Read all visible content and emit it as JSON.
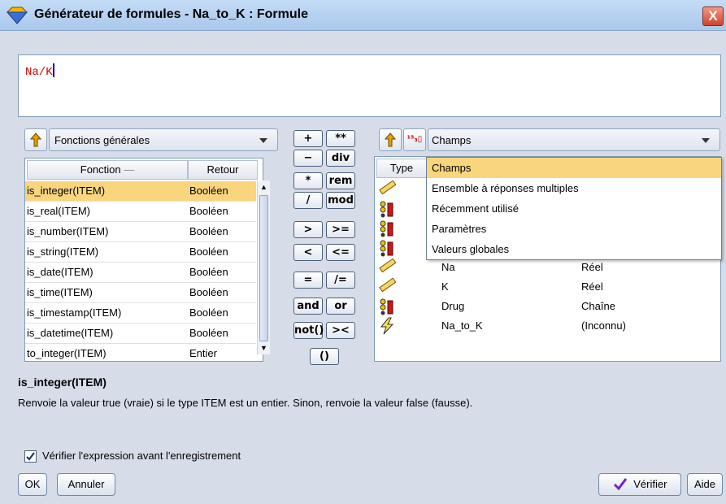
{
  "window": {
    "title": "Générateur de formules - Na_to_K : Formule",
    "close_label": "X"
  },
  "expression": {
    "text": "Na/K"
  },
  "functions": {
    "category": "Fonctions générales",
    "columns": [
      "Fonction",
      "Retour"
    ],
    "rows": [
      {
        "name": "is_integer(ITEM)",
        "ret": "Booléen"
      },
      {
        "name": "is_real(ITEM)",
        "ret": "Booléen"
      },
      {
        "name": "is_number(ITEM)",
        "ret": "Booléen"
      },
      {
        "name": "is_string(ITEM)",
        "ret": "Booléen"
      },
      {
        "name": "is_date(ITEM)",
        "ret": "Booléen"
      },
      {
        "name": "is_time(ITEM)",
        "ret": "Booléen"
      },
      {
        "name": "is_timestamp(ITEM)",
        "ret": "Booléen"
      },
      {
        "name": "is_datetime(ITEM)",
        "ret": "Booléen"
      },
      {
        "name": "to_integer(ITEM)",
        "ret": "Entier"
      }
    ],
    "selected_index": 0
  },
  "operators": [
    "+",
    "**",
    "−",
    "div",
    "*",
    "rem",
    "/",
    "mod",
    ">",
    ">=",
    "<",
    "<=",
    "=",
    "/=",
    "and",
    "or",
    "not()",
    "><",
    "()"
  ],
  "fields": {
    "source": "Champs",
    "type_header": "Type",
    "dropdown_options": [
      "Champs",
      "Ensemble à réponses multiples",
      "Récemment utilisé",
      "Paramètres",
      "Valeurs globales"
    ],
    "highlighted_option": "Champs",
    "rows": [
      {
        "type_icon": "continuous-ruler-icon",
        "name": "Na",
        "storage": "Réel"
      },
      {
        "type_icon": "continuous-ruler-icon",
        "name": "K",
        "storage": "Réel"
      },
      {
        "type_icon": "nominal-set-icon",
        "name": "Drug",
        "storage": "Chaîne"
      },
      {
        "type_icon": "derived-lightning-icon",
        "name": "Na_to_K",
        "storage": "(Inconnu)"
      }
    ]
  },
  "description": {
    "title": "is_integer(ITEM)",
    "text": "Renvoie la valeur true (vraie) si le type ITEM est un entier. Sinon, renvoie la valeur false (fausse)."
  },
  "check_before_save": {
    "label": "Vérifier l'expression avant l'enregistrement",
    "checked": true
  },
  "buttons": {
    "ok": "OK",
    "cancel": "Annuler",
    "verify": "Vérifier",
    "help": "Aide"
  },
  "colors": {
    "selection": "#f9d57e",
    "expression_text": "#d40000",
    "title_bar": "#b4d0f0"
  }
}
